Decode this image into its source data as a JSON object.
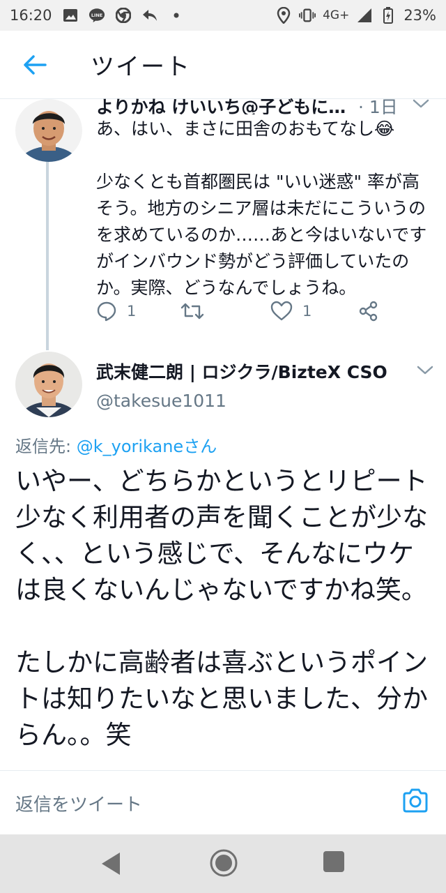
{
  "status_bar": {
    "time": "16:20",
    "network": "4G+",
    "battery": "23%",
    "icons": [
      "image-icon",
      "line-app-icon",
      "chrome-icon",
      "reply-arrow-icon",
      "dot-icon",
      "location-icon",
      "vibrate-icon",
      "signal-icon",
      "battery-icon"
    ]
  },
  "header": {
    "title": "ツイート"
  },
  "tweet1": {
    "name": "よりかね けいいち@子どもに…",
    "time": "· 1日",
    "body": "あ、はい、まさに田舎のおもてなし😂\n\n少なくとも首都圏民は \"いい迷惑\" 率が高そう。地方のシニア層は未だにこういうのを求めているのか……あと今はいないですがインバウンド勢がどう評価していたのか。実際、どうなんでしょうね。",
    "reply_count": "1",
    "like_count": "1"
  },
  "tweet2": {
    "name": "武末健二朗 | ロジクラ/BizteX CSO",
    "handle": "@takesue1011",
    "reply_to_prefix": "返信先: ",
    "reply_to_user": "@k_yorikaneさん",
    "body": "いやー、どちらかというとリピート少なく利用者の声を聞くことが少なく、、という感じで、そんなにウケは良くないんじゃないですかね笑。\n\nたしかに高齢者は喜ぶというポイントは知りたいなと思いました、分からん。。笑"
  },
  "reply_bar": {
    "placeholder": "返信をツイート"
  },
  "colors": {
    "accent": "#1da1f2",
    "text": "#141823",
    "muted": "#657786",
    "thread_line": "#c9d5de"
  }
}
